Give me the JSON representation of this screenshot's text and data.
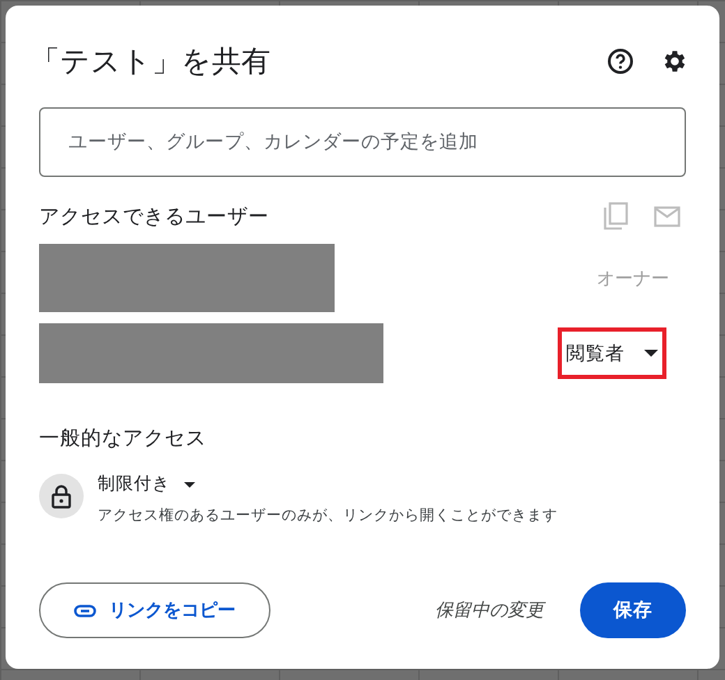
{
  "dialog": {
    "title": "「テスト」を共有"
  },
  "add_people": {
    "placeholder": "ユーザー、グループ、カレンダーの予定を追加"
  },
  "people_section": {
    "heading": "アクセスできるユーザー"
  },
  "people": [
    {
      "kind": "label",
      "role": "オーナー"
    },
    {
      "kind": "dropdown",
      "role": "閲覧者",
      "highlighted": true
    }
  ],
  "general_access": {
    "heading": "一般的なアクセス",
    "setting": "制限付き",
    "description": "アクセス権のあるユーザーのみが、リンクから開くことができます"
  },
  "footer": {
    "copy_link": "リンクをコピー",
    "pending": "保留中の変更",
    "save": "保存"
  }
}
